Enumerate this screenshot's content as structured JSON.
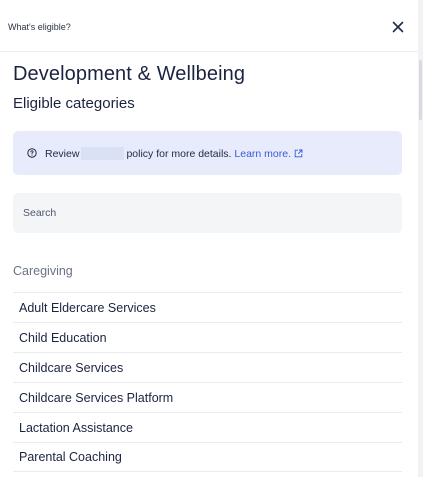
{
  "header": {
    "title": "What's eligible?",
    "close_icon": "close-icon"
  },
  "main": {
    "title": "Development & Wellbeing",
    "subtitle": "Eligible categories"
  },
  "info": {
    "icon": "info-icon",
    "text_before": "Review",
    "text_after": "policy for more details.",
    "link_label": "Learn more.",
    "link_icon": "external-link-icon"
  },
  "search": {
    "placeholder": "Search",
    "value": ""
  },
  "section": {
    "label": "Caregiving",
    "items": [
      {
        "label": "Adult Eldercare Services"
      },
      {
        "label": "Child Education"
      },
      {
        "label": "Childcare Services"
      },
      {
        "label": "Childcare Services Platform"
      },
      {
        "label": "Lactation Assistance"
      },
      {
        "label": "Parental Coaching"
      }
    ]
  },
  "colors": {
    "accent": "#3a5bd9",
    "info_background": "#e7ebfb",
    "search_background": "#f4f5f7",
    "text": "#1c2340"
  }
}
